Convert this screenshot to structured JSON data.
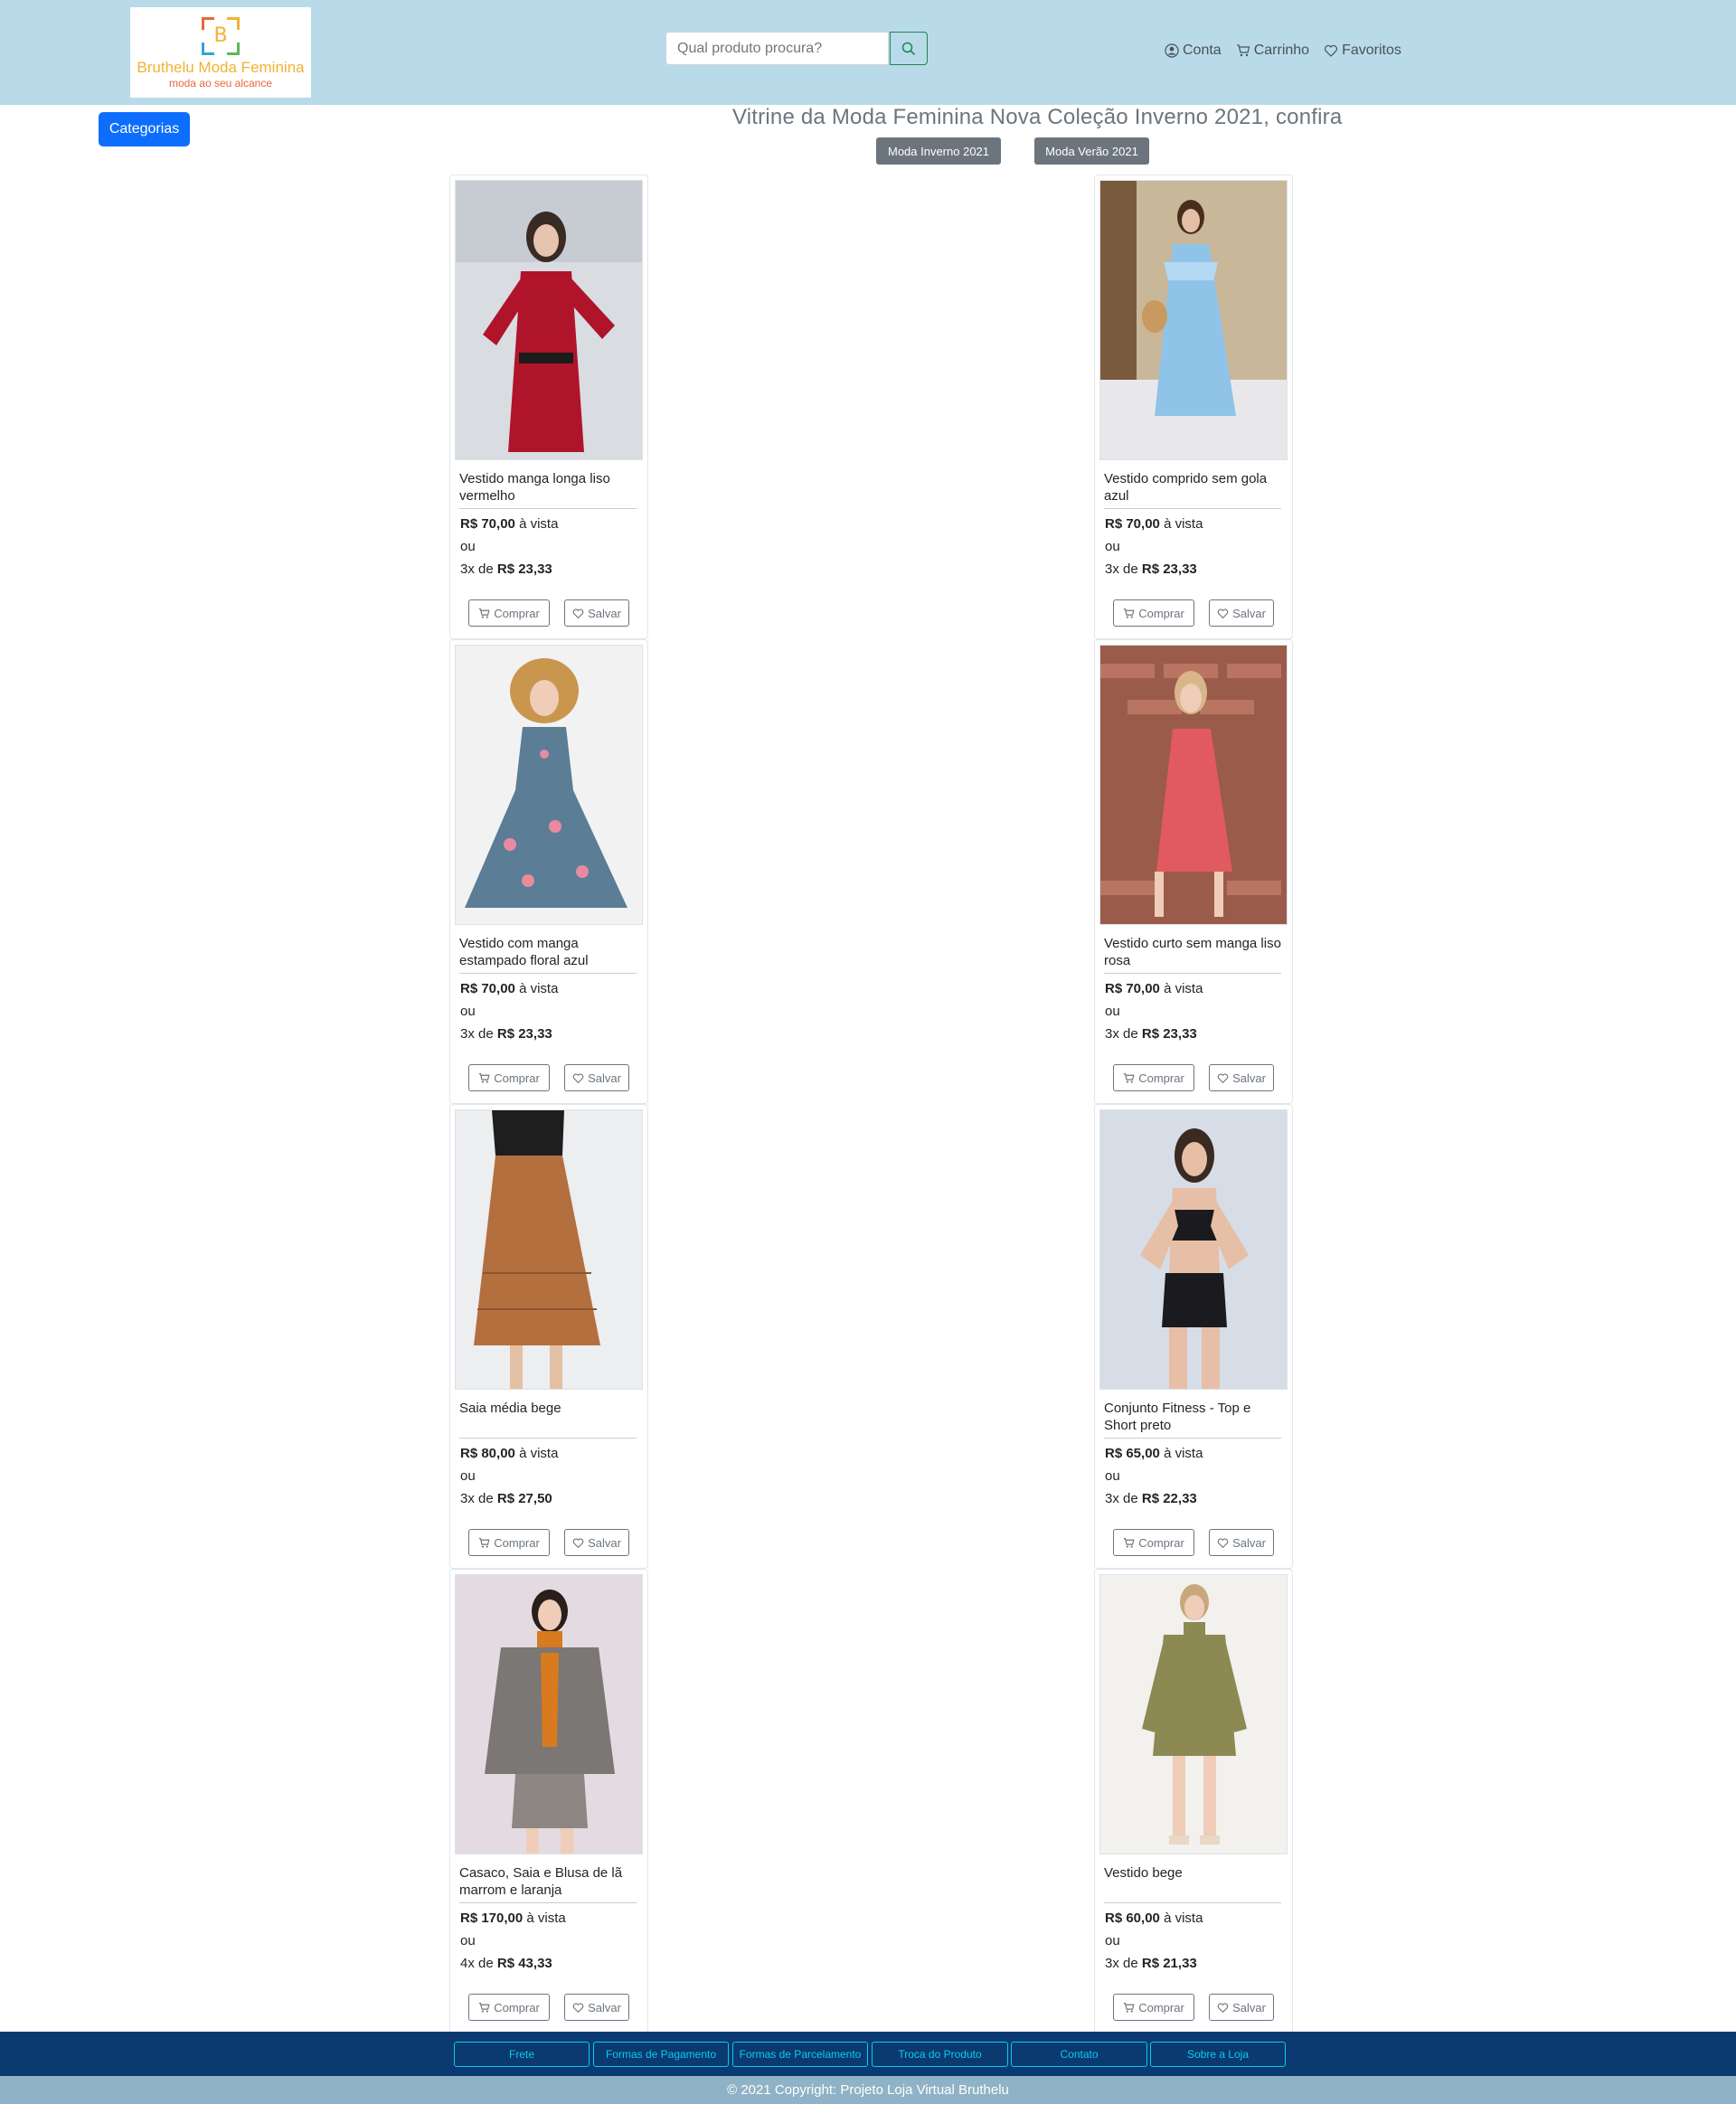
{
  "header": {
    "logo_name": "Bruthelu Moda Feminina",
    "logo_tagline": "moda ao seu alcance",
    "logo_letter": "B",
    "search_placeholder": "Qual produto procura?",
    "nav": {
      "account": "Conta",
      "cart": "Carrinho",
      "favorites": "Favoritos"
    }
  },
  "categories_button": "Categorias",
  "page_title": "Vitrine da Moda Feminina Nova Coleção Inverno 2021, confira",
  "season_buttons": [
    "Moda Inverno 2021",
    "Moda Verão 2021"
  ],
  "product_labels": {
    "or": "ou",
    "cash": "à vista",
    "buy": "Comprar",
    "save": "Salvar"
  },
  "products": [
    {
      "name": "Vestido manga longa liso vermelho",
      "price": "R$ 70,00",
      "installments": "3x de",
      "installment_value": "R$ 23,33"
    },
    {
      "name": "Vestido comprido sem gola azul",
      "price": "R$ 70,00",
      "installments": "3x de",
      "installment_value": "R$ 23,33"
    },
    {
      "name": "Vestido com manga estampado floral azul",
      "price": "R$ 70,00",
      "installments": "3x de",
      "installment_value": "R$ 23,33"
    },
    {
      "name": "Vestido curto sem manga liso rosa",
      "price": "R$ 70,00",
      "installments": "3x de",
      "installment_value": "R$ 23,33"
    },
    {
      "name": "Saia média bege",
      "price": "R$ 80,00",
      "installments": "3x de",
      "installment_value": "R$ 27,50"
    },
    {
      "name": "Conjunto Fitness - Top e Short preto",
      "price": "R$ 65,00",
      "installments": "3x de",
      "installment_value": "R$ 22,33"
    },
    {
      "name": "Casaco, Saia e Blusa de lã marrom e laranja",
      "price": "R$ 170,00",
      "installments": "4x de",
      "installment_value": "R$ 43,33"
    },
    {
      "name": "Vestido bege",
      "price": "R$ 60,00",
      "installments": "3x de",
      "installment_value": "R$ 21,33"
    }
  ],
  "footer_links": [
    "Frete",
    "Formas de Pagamento",
    "Formas de Parcelamento",
    "Troca do Produto",
    "Contato",
    "Sobre a Loja"
  ],
  "copyright": "© 2021 Copyright: Projeto Loja Virtual Bruthelu",
  "colors": {
    "header_bg": "#b9dbe9",
    "primary": "#0d6efd",
    "footer_bg": "#0a3a6f",
    "footer_link": "#0dcaf0",
    "copyright_bg": "#8fb2c6"
  }
}
